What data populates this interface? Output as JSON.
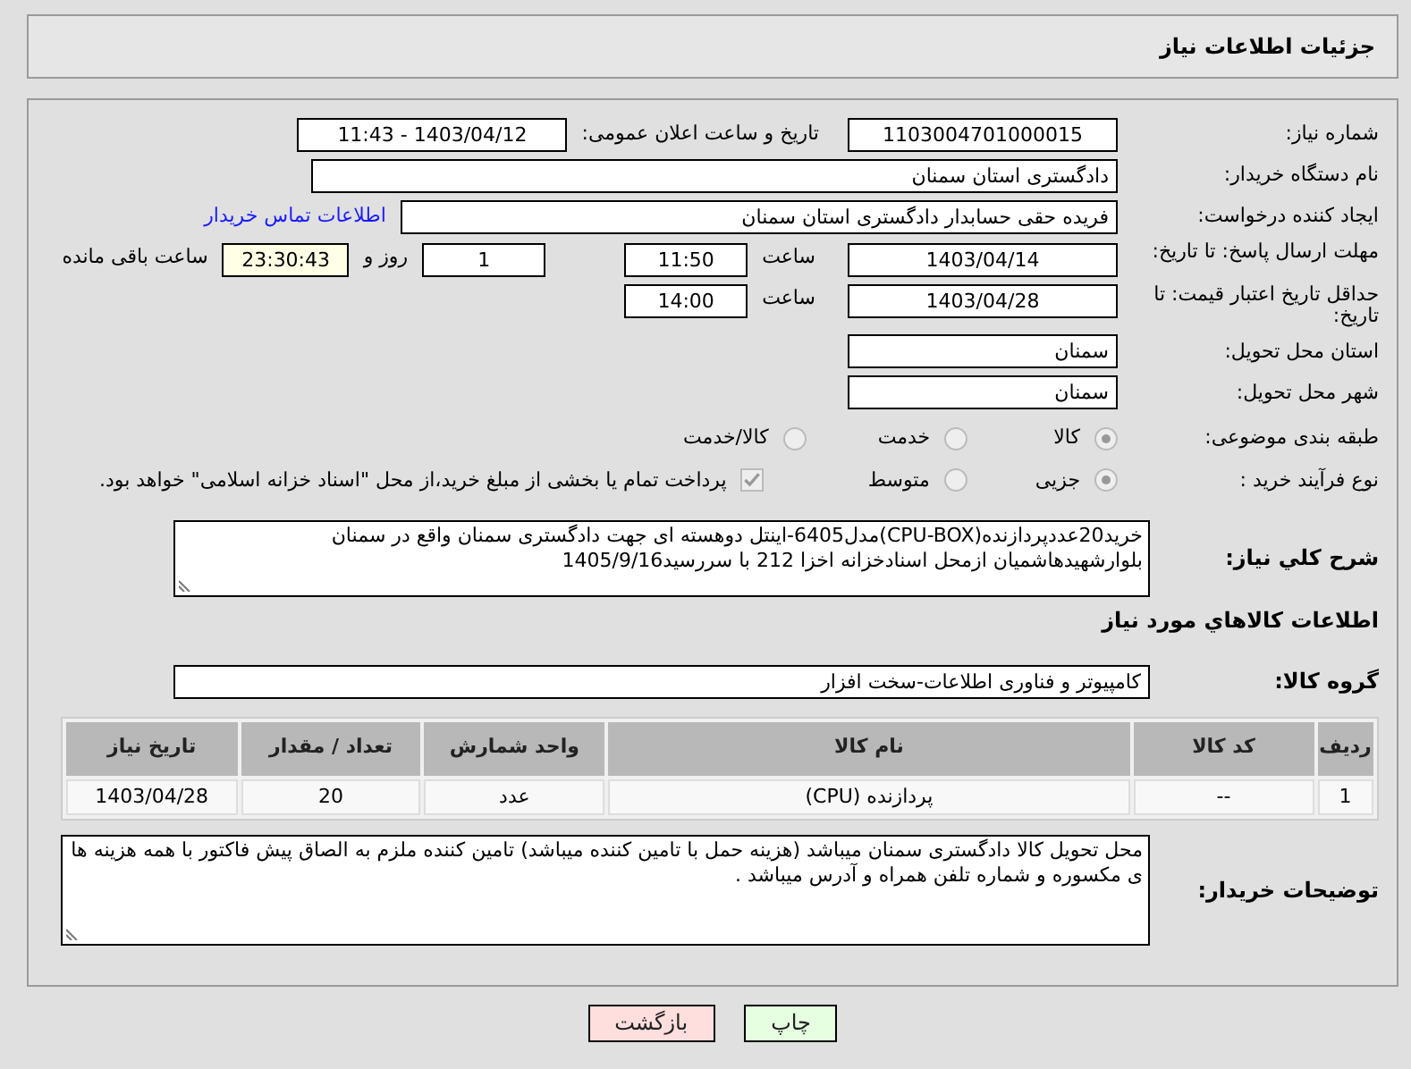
{
  "header": {
    "title": "جزئیات اطلاعات نیاز"
  },
  "need_number": {
    "label": "شماره نیاز:",
    "value": "1103004701000015"
  },
  "announce": {
    "label": "تاریخ و ساعت اعلان عمومی:",
    "value": "1403/04/12 - 11:43"
  },
  "buyer_org": {
    "label": "نام دستگاه خریدار:",
    "value": "دادگستری استان سمنان"
  },
  "requester": {
    "label": "ایجاد کننده درخواست:",
    "value": "فریده حقی حسابدار دادگستری استان سمنان",
    "link": "اطلاعات تماس خریدار"
  },
  "reply_deadline": {
    "label": "مهلت ارسال پاسخ: تا تاریخ:",
    "date": "1403/04/14",
    "time_label": "ساعت",
    "time": "11:50",
    "days": "1",
    "days_label": "روز و",
    "remaining": "23:30:43",
    "remaining_label": "ساعت باقی مانده"
  },
  "price_validity": {
    "label": "حداقل تاریخ اعتبار قیمت: تا تاریخ:",
    "date": "1403/04/28",
    "time_label": "ساعت",
    "time": "14:00"
  },
  "province": {
    "label": "استان محل تحویل:",
    "value": "سمنان"
  },
  "city": {
    "label": "شهر محل تحویل:",
    "value": "سمنان"
  },
  "category": {
    "label": "طبقه بندی موضوعی:",
    "options": [
      {
        "label": "کالا",
        "selected": true
      },
      {
        "label": "خدمت",
        "selected": false
      },
      {
        "label": "کالا/خدمت",
        "selected": false
      }
    ]
  },
  "process": {
    "label": "نوع فرآیند خرید :",
    "options": [
      {
        "label": "جزیی",
        "selected": true
      },
      {
        "label": "متوسط",
        "selected": false
      }
    ],
    "treasury": {
      "checked": true,
      "text": "پرداخت تمام یا بخشی از مبلغ خرید،از محل \"اسناد خزانه اسلامی\" خواهد بود."
    }
  },
  "description": {
    "label": "شرح كلي نياز:",
    "text": "خرید20عددپردازنده(CPU-BOX)مدل6405-اینتل دوهسته ای جهت دادگستری سمنان واقع در سمنان بلوارشهیدهاشمیان ازمحل اسنادخزانه  اخزا 212 با سررسید1405/9/16"
  },
  "goods_heading": "اطلاعات كالاهاي مورد نياز",
  "goods_group": {
    "label": "گروه کالا:",
    "value": "کامپیوتر و فناوری اطلاعات-سخت افزار"
  },
  "table": {
    "columns": [
      "ردیف",
      "کد کالا",
      "نام کالا",
      "واحد شمارش",
      "تعداد / مقدار",
      "تاریخ نیاز"
    ],
    "rows": [
      [
        "1",
        "--",
        "پردازنده (CPU)",
        "عدد",
        "20",
        "1403/04/28"
      ]
    ]
  },
  "buyer_notes": {
    "label": "توضیحات خریدار:",
    "text": "محل تحویل کالا دادگستری سمنان میباشد (هزینه حمل با تامین کننده میباشد) تامین کننده ملزم به الصاق پیش فاکتور با همه هزینه ها ی مکسوره و شماره تلفن همراه و آدرس میباشد ."
  },
  "buttons": [
    {
      "label": "چاپ",
      "color": "#e6ffe0"
    },
    {
      "label": "بازگشت",
      "color": "#ffdede"
    }
  ]
}
